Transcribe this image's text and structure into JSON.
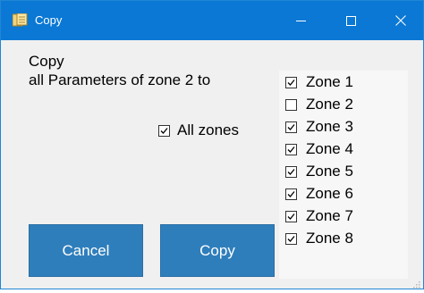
{
  "window": {
    "title": "Copy",
    "icon": "copy-app-icon",
    "controls": {
      "minimize_icon": "minimize-icon",
      "maximize_icon": "maximize-icon",
      "close_icon": "close-icon"
    },
    "accent_color": "#0a78d4"
  },
  "message": {
    "line1": "Copy",
    "line2": "all Parameters of zone 2 to"
  },
  "all_zones": {
    "label": "All zones",
    "checked": true
  },
  "zones": [
    {
      "label": "Zone 1",
      "checked": true
    },
    {
      "label": "Zone 2",
      "checked": false
    },
    {
      "label": "Zone 3",
      "checked": true
    },
    {
      "label": "Zone 4",
      "checked": true
    },
    {
      "label": "Zone 5",
      "checked": true
    },
    {
      "label": "Zone 6",
      "checked": true
    },
    {
      "label": "Zone 7",
      "checked": true
    },
    {
      "label": "Zone 8",
      "checked": true
    }
  ],
  "buttons": {
    "cancel_label": "Cancel",
    "copy_label": "Copy",
    "color": "#2f7ebc"
  }
}
